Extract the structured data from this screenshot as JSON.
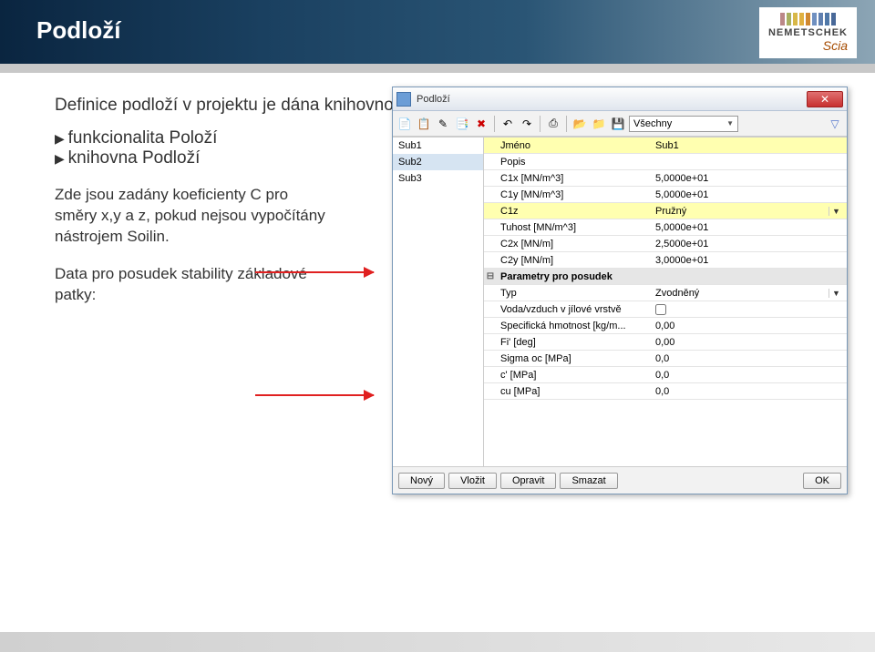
{
  "page": {
    "title": "Podloží",
    "logo_text": "NEMETSCHEK",
    "logo_sub": "Scia",
    "intro": "Definice podloží v projektu je dána knihovnou:",
    "bullet1": "funkcionalita Položí",
    "bullet2": "knihovna Podloží",
    "para1": "Zde jsou zadány koeficienty C pro směry x,y a z, pokud nejsou vypočítány nástrojem Soilin.",
    "para2": "Data pro posudek stability základové patky:"
  },
  "dlg": {
    "title": "Podloží",
    "dd": "Všechny",
    "list": [
      "Sub1",
      "Sub2",
      "Sub3"
    ],
    "rows": [
      {
        "lbl": "Jméno",
        "val": "Sub1",
        "hl": true
      },
      {
        "lbl": "Popis",
        "val": ""
      },
      {
        "lbl": "C1x [MN/m^3]",
        "val": "5,0000e+01"
      },
      {
        "lbl": "C1y [MN/m^3]",
        "val": "5,0000e+01"
      },
      {
        "lbl": "C1z",
        "val": "Pružný",
        "hl": true,
        "dd": true
      },
      {
        "lbl": "Tuhost [MN/m^3]",
        "val": "5,0000e+01"
      },
      {
        "lbl": "C2x [MN/m]",
        "val": "2,5000e+01"
      },
      {
        "lbl": "C2y [MN/m]",
        "val": "3,0000e+01"
      }
    ],
    "group": "Parametry pro posudek",
    "rows2": [
      {
        "lbl": "Typ",
        "val": "Zvodněný",
        "dd": true
      },
      {
        "lbl": "Voda/vzduch v jílové vrstvě",
        "val": "",
        "cb": true
      },
      {
        "lbl": "Specifická hmotnost [kg/m...",
        "val": "0,00"
      },
      {
        "lbl": "Fi' [deg]",
        "val": "0,00"
      },
      {
        "lbl": "Sigma oc [MPa]",
        "val": "0,0"
      },
      {
        "lbl": "c' [MPa]",
        "val": "0,0"
      },
      {
        "lbl": "cu [MPa]",
        "val": "0,0"
      }
    ],
    "btns": {
      "novy": "Nový",
      "vlozit": "Vložit",
      "opravit": "Opravit",
      "smazat": "Smazat",
      "ok": "OK"
    }
  }
}
